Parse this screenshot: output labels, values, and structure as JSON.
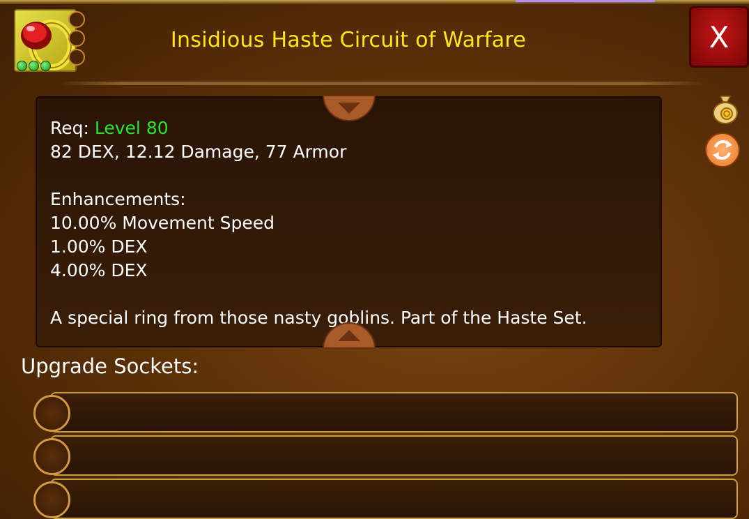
{
  "item": {
    "title": "Insidious Haste Circuit of Warfare",
    "icon": "ring-icon",
    "gem_slot_count": 3,
    "quality_dots": 3
  },
  "close_button": {
    "label": "X"
  },
  "description": {
    "req_label": "Req:",
    "req_value": "Level 80",
    "stats": "82 DEX, 12.12 Damage, 77 Armor",
    "enhancements_label": "Enhancements:",
    "enhancements": [
      "10.00% Movement Speed",
      "1.00% DEX",
      "4.00% DEX"
    ],
    "flavor": "A special ring from those nasty goblins. Part of the Haste Set."
  },
  "side_buttons": [
    "gold-bag-icon",
    "refresh-icon"
  ],
  "upgrade": {
    "label": "Upgrade Sockets:",
    "socket_count": 3
  },
  "colors": {
    "title": "#ffe61a",
    "level": "#2ae62a",
    "close": "#c21616"
  }
}
